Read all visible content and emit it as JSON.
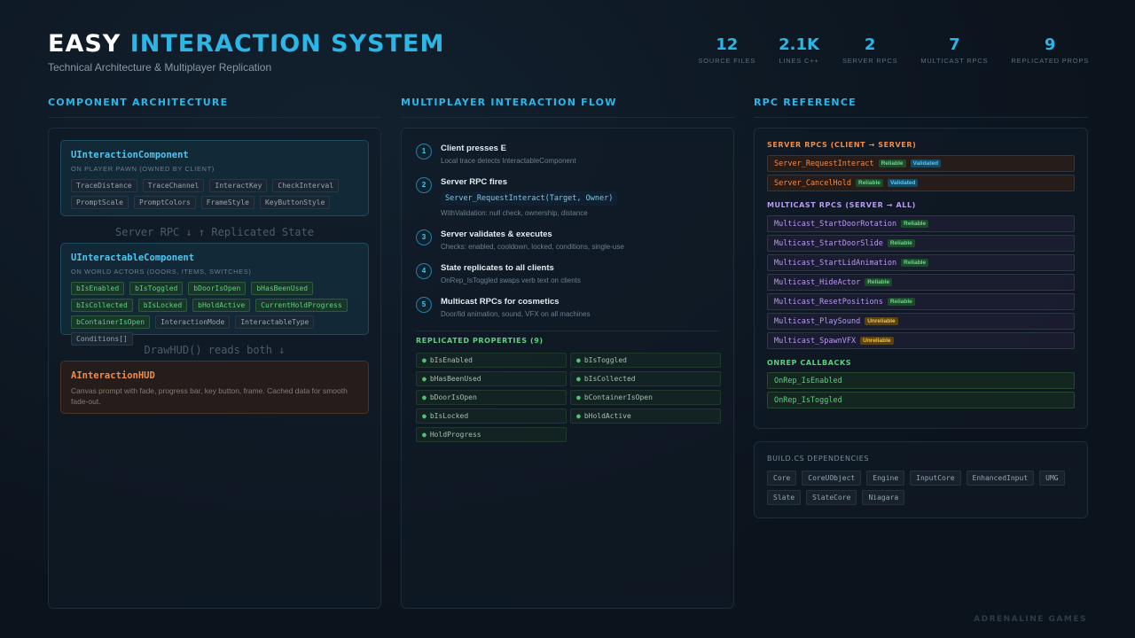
{
  "header": {
    "title_part1": "EASY",
    "title_part2": "INTERACTION SYSTEM",
    "subtitle": "Technical Architecture & Multiplayer Replication"
  },
  "stats": [
    {
      "value": "12",
      "label": "SOURCE FILES"
    },
    {
      "value": "2.1K",
      "label": "LINES C++"
    },
    {
      "value": "2",
      "label": "SERVER RPCS"
    },
    {
      "value": "7",
      "label": "MULTICAST RPCS"
    },
    {
      "value": "9",
      "label": "REPLICATED PROPS"
    }
  ],
  "sections": {
    "architecture": "COMPONENT ARCHITECTURE",
    "flow": "MULTIPLAYER INTERACTION FLOW",
    "rpc": "RPC REFERENCE"
  },
  "architecture": {
    "interaction_component": {
      "name": "UInteractionComponent",
      "sub": "ON PLAYER PAWN (OWNED BY CLIENT)",
      "tags": [
        "TraceDistance",
        "TraceChannel",
        "InteractKey",
        "CheckInterval",
        "PromptScale",
        "PromptColors",
        "FrameStyle",
        "KeyButtonStyle"
      ]
    },
    "connector1": "Server RPC ↓ ↑ Replicated State",
    "interactable_component": {
      "name": "UInteractableComponent",
      "sub": "ON WORLD ACTORS (DOORS, ITEMS, SWITCHES)",
      "replicated_tags": [
        "bIsEnabled",
        "bIsToggled",
        "bDoorIsOpen",
        "bHasBeenUsed",
        "bIsCollected",
        "bIsLocked",
        "bHoldActive",
        "CurrentHoldProgress",
        "bContainerIsOpen"
      ],
      "tags": [
        "InteractionMode",
        "InteractableType",
        "Conditions[]"
      ]
    },
    "connector2": "DrawHUD() reads both ↓",
    "hud": {
      "name": "AInteractionHUD",
      "desc": "Canvas prompt with fade, progress bar, key button, frame. Cached data for smooth fade-out."
    }
  },
  "flow": {
    "steps": [
      {
        "num": "1",
        "title": "Client presses E",
        "desc": "Local trace detects InteractableComponent"
      },
      {
        "num": "2",
        "title": "Server RPC fires",
        "code": "Server_RequestInteract(Target, Owner)",
        "desc": "WithValidation: null check, ownership, distance"
      },
      {
        "num": "3",
        "title": "Server validates & executes",
        "desc": "Checks: enabled, cooldown, locked, conditions, single-use"
      },
      {
        "num": "4",
        "title": "State replicates to all clients",
        "desc": "OnRep_IsToggled swaps verb text on clients"
      },
      {
        "num": "5",
        "title": "Multicast RPCs for cosmetics",
        "desc": "Door/lid animation, sound, VFX on all machines"
      }
    ],
    "props_heading": "REPLICATED PROPERTIES (9)",
    "props": [
      "bIsEnabled",
      "bIsToggled",
      "bHasBeenUsed",
      "bIsCollected",
      "bDoorIsOpen",
      "bContainerIsOpen",
      "bIsLocked",
      "bHoldActive",
      "HoldProgress"
    ]
  },
  "rpc": {
    "server_heading": "SERVER RPCS (CLIENT → SERVER)",
    "server": [
      {
        "name": "Server_RequestInteract",
        "badges": [
          "Reliable",
          "Validated"
        ]
      },
      {
        "name": "Server_CancelHold",
        "badges": [
          "Reliable",
          "Validated"
        ]
      }
    ],
    "multicast_heading": "MULTICAST RPCS (SERVER → ALL)",
    "multicast": [
      {
        "name": "Multicast_StartDoorRotation",
        "badge": "Reliable"
      },
      {
        "name": "Multicast_StartDoorSlide",
        "badge": "Reliable"
      },
      {
        "name": "Multicast_StartLidAnimation",
        "badge": "Reliable"
      },
      {
        "name": "Multicast_HideActor",
        "badge": "Reliable"
      },
      {
        "name": "Multicast_ResetPositions",
        "badge": "Reliable"
      },
      {
        "name": "Multicast_PlaySound",
        "badge": "Unreliable"
      },
      {
        "name": "Multicast_SpawnVFX",
        "badge": "Unreliable"
      }
    ],
    "onrep_heading": "ONREP CALLBACKS",
    "onrep": [
      "OnRep_IsEnabled",
      "OnRep_IsToggled"
    ]
  },
  "deps": {
    "heading": "BUILD.CS DEPENDENCIES",
    "items": [
      "Core",
      "CoreUObject",
      "Engine",
      "InputCore",
      "EnhancedInput",
      "UMG",
      "Slate",
      "SlateCore",
      "Niagara"
    ]
  },
  "footer": "ADRENALINE GAMES",
  "colors": {
    "accent": "#2bb6e8",
    "orange": "#f08c4a",
    "purple": "#b79af3",
    "green": "#5ed07f"
  }
}
